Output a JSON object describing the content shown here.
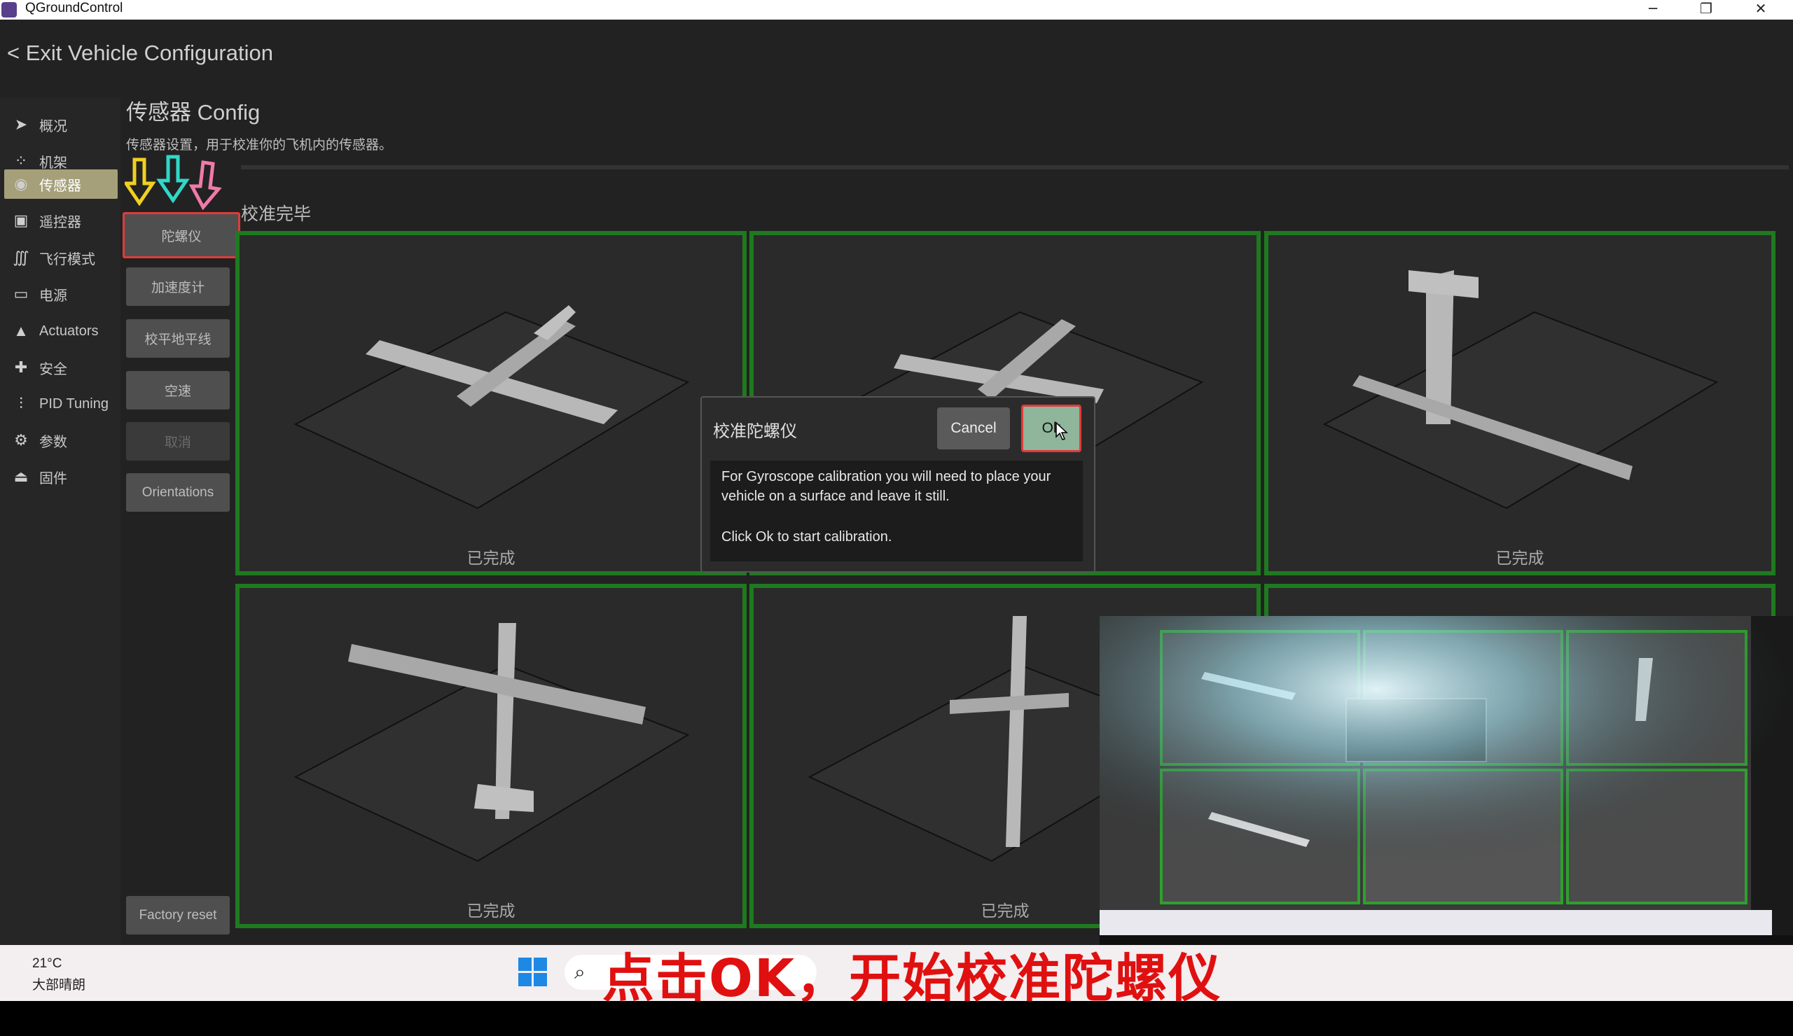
{
  "window": {
    "title": "QGroundControl",
    "minimize": "─",
    "restore": "❐",
    "close": "✕"
  },
  "header": {
    "exit_label": "< Exit Vehicle Configuration"
  },
  "sidebar": {
    "items": [
      {
        "label": "概况",
        "icon": "plane-icon"
      },
      {
        "label": "机架",
        "icon": "airframe-icon"
      },
      {
        "label": "传感器",
        "icon": "sensor-icon"
      },
      {
        "label": "遥控器",
        "icon": "radio-icon"
      },
      {
        "label": "飞行模式",
        "icon": "flight-mode-icon"
      },
      {
        "label": "电源",
        "icon": "battery-icon"
      },
      {
        "label": "Actuators",
        "icon": "actuators-icon"
      },
      {
        "label": "安全",
        "icon": "safety-icon"
      },
      {
        "label": "PID Tuning",
        "icon": "tuning-icon"
      },
      {
        "label": "参数",
        "icon": "parameters-icon"
      },
      {
        "label": "固件",
        "icon": "firmware-icon"
      }
    ]
  },
  "page": {
    "title": "传感器 Config",
    "description": "传感器设置，用于校准你的飞机内的传感器。",
    "status": "校准完毕",
    "buttons": {
      "gyro": "陀螺仪",
      "accel": "加速度计",
      "level": "校平地平线",
      "airspeed": "空速",
      "cancel": "取消",
      "orientations": "Orientations",
      "factory_reset": "Factory reset"
    },
    "cell_label": "已完成"
  },
  "dialog": {
    "title": "校准陀螺仪",
    "cancel": "Cancel",
    "ok": "Ok",
    "line1": "For Gyroscope calibration you will need to place your",
    "line2": "vehicle on a surface and leave it still.",
    "line3": "Click Ok to start calibration."
  },
  "taskbar": {
    "temp": "21°C",
    "weather": "大部晴朗"
  },
  "subtitle": "点击OK，开始校准陀螺仪",
  "colors": {
    "accent": "#a6a07a",
    "complete_border": "#1f7a1f",
    "highlight": "#e23a3a",
    "ok_button": "#8fb59a"
  }
}
